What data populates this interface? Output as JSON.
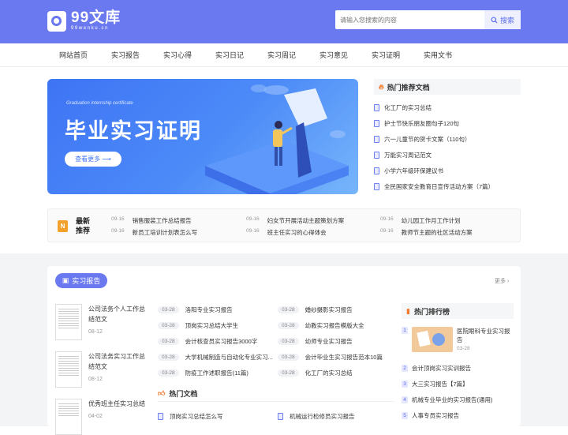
{
  "header": {
    "logo_main": "99文库",
    "logo_sub": "99wenku.cn",
    "search_placeholder": "请输入您搜索的内容",
    "search_button": "搜索"
  },
  "nav": [
    "网站首页",
    "实习报告",
    "实习心得",
    "实习日记",
    "实习周记",
    "实习意见",
    "实习证明",
    "实用文书"
  ],
  "banner": {
    "subtitle": "Graduation internship certificate",
    "title": "毕业实习证明",
    "button": "查看更多"
  },
  "hot_docs": {
    "title": "热门推荐文档",
    "items": [
      "化工厂的实习总结",
      "护士节快乐朋友圈句子120句",
      "六一儿童节的贺卡文案（110句）",
      "万能实习周记范文",
      "小学六年级环保建议书",
      "全民国家安全教育日宣传活动方案（7篇）"
    ]
  },
  "recent": {
    "label_line1": "最新",
    "label_line2": "推荐",
    "items": [
      {
        "date": "09-16",
        "text": "销售服装工作总结报告"
      },
      {
        "date": "09-16",
        "text": "妇女节开展活动主题策划方案"
      },
      {
        "date": "09-16",
        "text": "幼儿园工作月工作计划"
      },
      {
        "date": "09-16",
        "text": "新员工培训计划表怎么写"
      },
      {
        "date": "09-16",
        "text": "班主任实习的心得体会"
      },
      {
        "date": "09-16",
        "text": "教师节主题的社区活动方案"
      }
    ]
  },
  "section": {
    "title": "实习报告",
    "more": "更多",
    "cards": [
      {
        "title": "公司法务个人工作总结范文",
        "date": "08-12"
      },
      {
        "title": "公司法务实习工作总结范文",
        "date": "08-12"
      },
      {
        "title": "优秀班主任实习总结",
        "date": "04-02"
      }
    ],
    "list_left": [
      {
        "date": "03-28",
        "text": "洛阳专业实习报告"
      },
      {
        "date": "03-28",
        "text": "顶岗实习总结大学生"
      },
      {
        "date": "03-28",
        "text": "会计核查员实习报告3000字"
      },
      {
        "date": "03-28",
        "text": "大学机械制造与自动化专业实习..."
      },
      {
        "date": "03-28",
        "text": "防疫工作述职报告(11篇)"
      }
    ],
    "list_right": [
      {
        "date": "03-28",
        "text": "婚纱摄影实习报告"
      },
      {
        "date": "03-28",
        "text": "幼教实习报告模版大全"
      },
      {
        "date": "03-28",
        "text": "幼师专业实习报告"
      },
      {
        "date": "03-28",
        "text": "会计毕业生实习报告范本10篇"
      },
      {
        "date": "03-28",
        "text": "化工厂的实习总结"
      }
    ],
    "hot_sub": {
      "title": "热门文档",
      "items": [
        "顶岗实习总结怎么写",
        "机械运行检修员实习报告"
      ]
    }
  },
  "rank": {
    "title": "热门排行榜",
    "top": {
      "num": "1",
      "title": "医院眼科专业实习报告",
      "date": "03-28"
    },
    "items": [
      {
        "num": "2",
        "text": "会计顶岗实习实训报告"
      },
      {
        "num": "3",
        "text": "大三实习报告【7篇】"
      },
      {
        "num": "4",
        "text": "机械专业毕业的实习报告(通用)"
      },
      {
        "num": "5",
        "text": "人事专员实习报告"
      }
    ]
  }
}
